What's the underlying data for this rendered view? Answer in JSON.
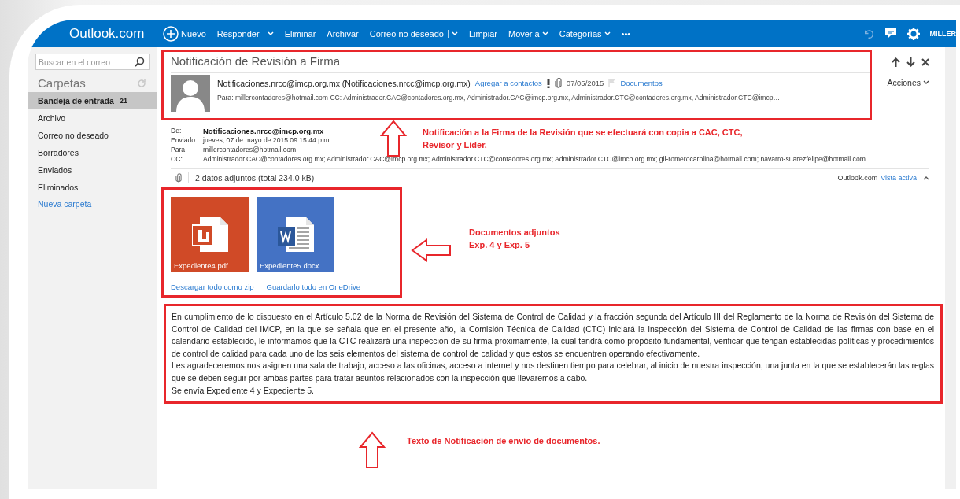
{
  "nav": {
    "logo": "Outlook.com",
    "user": "MILLER",
    "actions": [
      {
        "label": "Nuevo",
        "kind": "new"
      },
      {
        "label": "Responder",
        "kind": "split"
      },
      {
        "label": "Eliminar",
        "kind": "plain"
      },
      {
        "label": "Archivar",
        "kind": "plain"
      },
      {
        "label": "Correo no deseado",
        "kind": "split"
      },
      {
        "label": "Limpiar",
        "kind": "plain"
      },
      {
        "label": "Mover a",
        "kind": "dropdown"
      },
      {
        "label": "Categorías",
        "kind": "dropdown"
      },
      {
        "label": "•••",
        "kind": "plain"
      }
    ]
  },
  "sidebar": {
    "search_placeholder": "Buscar en el correo",
    "heading": "Carpetas",
    "folders": [
      {
        "label": "Bandeja de entrada",
        "count": "21",
        "selected": true
      },
      {
        "label": "Archivo",
        "selected": false
      },
      {
        "label": "Correo no deseado",
        "selected": false
      },
      {
        "label": "Borradores",
        "selected": false
      },
      {
        "label": "Enviados",
        "selected": false
      },
      {
        "label": "Eliminados",
        "selected": false
      }
    ],
    "new_folder": "Nueva carpeta"
  },
  "message": {
    "subject": "Notificación de Revisión a Firma",
    "sender": "Notificaciones.nrcc@imcp.org.mx",
    "sender_address": "(Notificaciones.nrcc@imcp.org.mx)",
    "add_contact": "Agregar a contactos",
    "date": "07/05/2015",
    "category": "Documentos",
    "recipients": "Para: millercontadores@hotmail.com CC: Administrador.CAC@contadores.org.mx, Administrador.CAC@imcp.org.mx, Administrador.CTC@contadores.org.mx, Administrador.CTC@imcp…",
    "actions": "Acciones"
  },
  "details": [
    {
      "label": "De:",
      "value": "Notificaciones.nrcc@imcp.org.mx",
      "emphasized": true
    },
    {
      "label": "Enviado:",
      "value": "jueves, 07 de mayo de 2015 09:15:44 p.m.",
      "emphasized": false
    },
    {
      "label": "Para:",
      "value": "millercontadores@hotmail.com",
      "emphasized": false
    },
    {
      "label": "CC:",
      "value": "Administrador.CAC@contadores.org.mx; Administrador.CAC@imcp.org.mx; Administrador.CTC@contadores.org.mx; Administrador.CTC@imcp.org.mx; gil-romerocarolina@hotmail.com; navarro-suarezfelipe@hotmail.com",
      "emphasized": false
    }
  ],
  "attachments": {
    "summary": "2 datos adjuntos (total 234.0 kB)",
    "viewer": "Outlook.com",
    "view_link": "Vista activa",
    "files": [
      {
        "name": "Expediente4.pdf",
        "kind": "pdf"
      },
      {
        "name": "Expediente5.docx",
        "kind": "word"
      }
    ],
    "links": [
      "Descargar todo como zip",
      "Guardarlo todo en OneDrive"
    ]
  },
  "body": [
    "En cumplimiento de lo dispuesto en el Artículo 5.02 de la Norma de Revisión del Sistema de Control de Calidad y la fracción segunda del Artículo III del Reglamento de la Norma de Revisión del Sistema de Control de Calidad del IMCP, en la que se señala que en el presente año, la Comisión Técnica de Calidad (CTC) iniciará la inspección del Sistema de Control de Calidad de las firmas con base en el calendario establecido, le informamos que la CTC realizará una inspección de su firma próximamente, la cual tendrá como propósito fundamental, verificar que tengan establecidas políticas y procedimientos de control de calidad para cada uno de los seis elementos del sistema de control de calidad y que estos se encuentren operando efectivamente.",
    "Les agradeceremos nos asignen una sala de trabajo, acceso a las oficinas, acceso a internet y nos destinen tiempo para celebrar, al inicio de nuestra inspección, una junta en la que se establecerán las reglas que se deben seguir por ambas partes para tratar asuntos relacionados con la inspección que llevaremos a cabo.",
    "Se envía Expediente 4 y Expediente 5."
  ],
  "annotations": [
    {
      "lines": [
        "Notificación a la Firma de la Revisión que se efectuará con copia a CAC, CTC,",
        "Revisor y Líder."
      ]
    },
    {
      "lines": [
        "Documentos adjuntos",
        "Exp. 4 y Exp. 5"
      ]
    },
    {
      "lines": [
        "Texto de Notificación de envío de documentos."
      ]
    }
  ]
}
